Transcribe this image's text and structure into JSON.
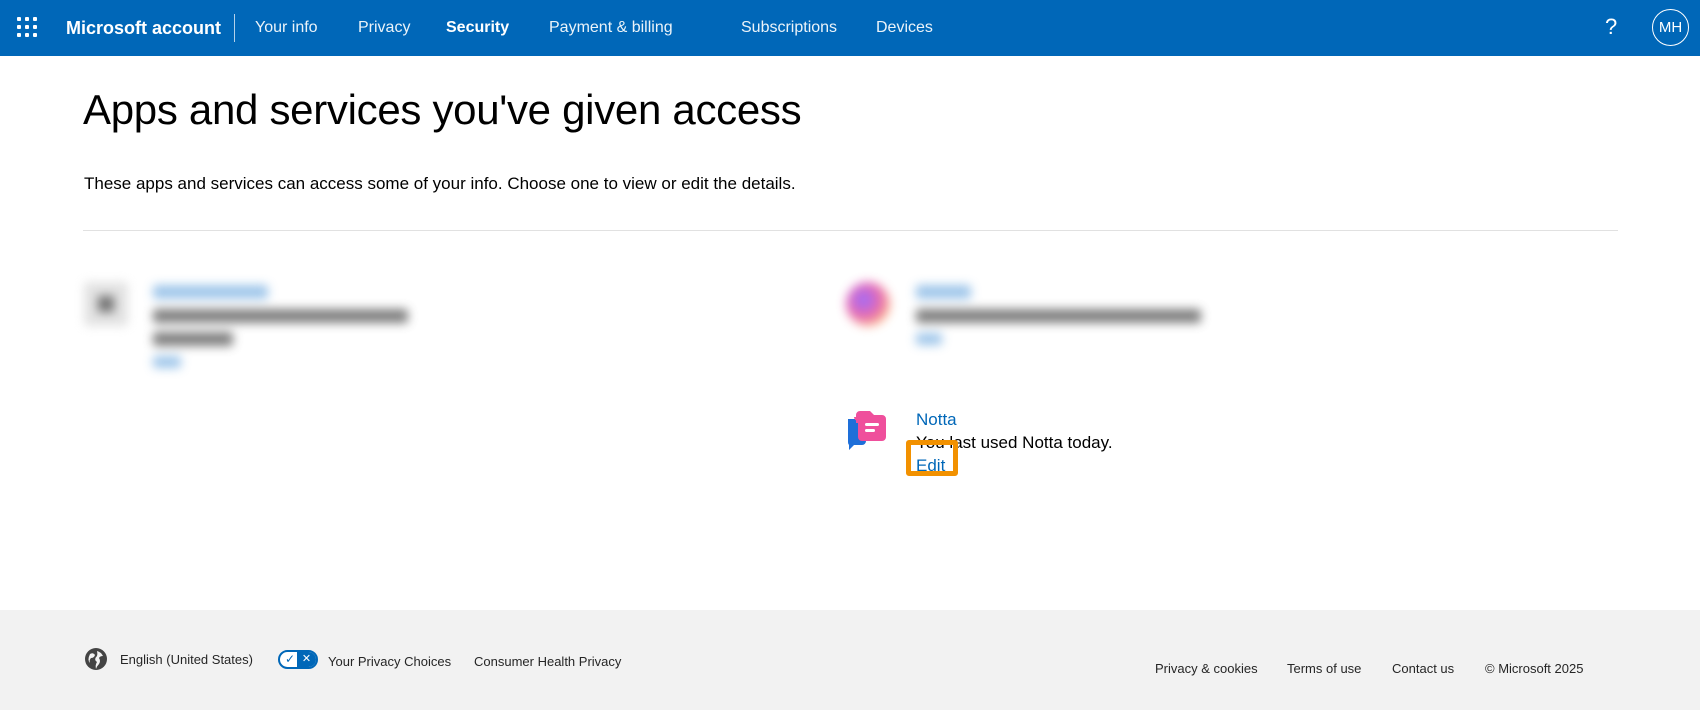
{
  "header": {
    "brand": "Microsoft account",
    "nav": [
      "Your info",
      "Privacy",
      "Security",
      "Payment & billing",
      "Subscriptions",
      "Devices"
    ],
    "active_nav": "Security",
    "help_label": "?",
    "avatar_initials": "MH",
    "bar_color": "#0067b8"
  },
  "main": {
    "title": "Apps and services you've given access",
    "intro": "These apps and services can access some of your info. Choose one to view or edit the details.",
    "apps": [
      {
        "name": "Notta",
        "description": "You last used Notta today.",
        "edit_label": "Edit",
        "icon": "notta-app-icon",
        "highlighted": true
      }
    ]
  },
  "footer": {
    "language": "English (United States)",
    "privacy_choices": "Your Privacy Choices",
    "health_privacy": "Consumer Health Privacy",
    "links": [
      "Privacy & cookies",
      "Terms of use",
      "Contact us"
    ],
    "copyright": "© Microsoft 2025"
  },
  "colors": {
    "link": "#0067b8",
    "highlight": "#f29100",
    "footer_bg": "#f2f2f2"
  }
}
